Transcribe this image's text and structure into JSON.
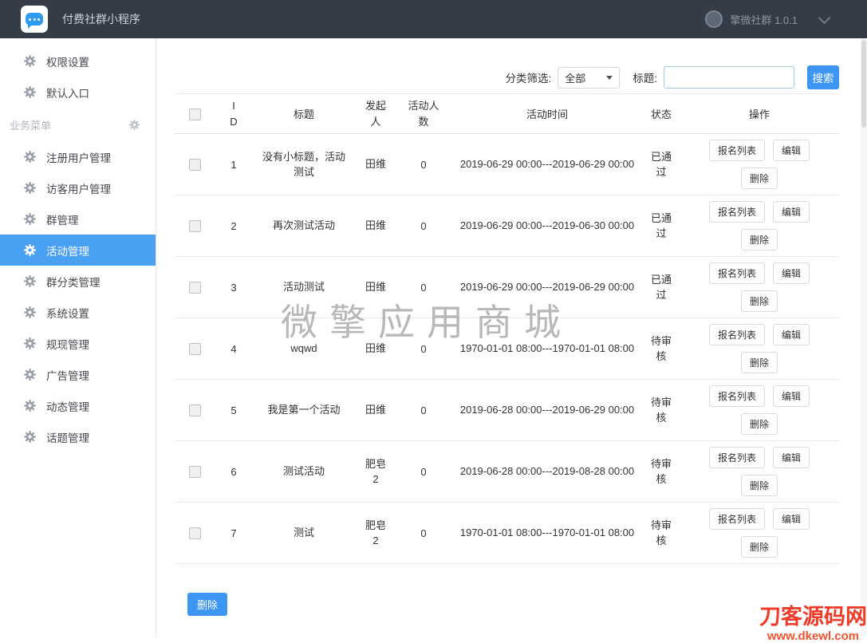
{
  "header": {
    "app_title": "付费社群小程序",
    "brand_label": "擎微社群 1.0.1"
  },
  "sidebar": {
    "top_items": [
      {
        "label": "权限设置"
      },
      {
        "label": "默认入口"
      }
    ],
    "section": {
      "label": "业务菜单"
    },
    "menu_items": [
      {
        "label": "注册用户管理",
        "active": false
      },
      {
        "label": "访客用户管理",
        "active": false
      },
      {
        "label": "群管理",
        "active": false
      },
      {
        "label": "活动管理",
        "active": true
      },
      {
        "label": "群分类管理",
        "active": false
      },
      {
        "label": "系统设置",
        "active": false
      },
      {
        "label": "规现管理",
        "active": false
      },
      {
        "label": "广告管理",
        "active": false
      },
      {
        "label": "动态管理",
        "active": false
      },
      {
        "label": "话题管理",
        "active": false
      }
    ]
  },
  "filters": {
    "category_label": "分类筛选:",
    "category_value": "全部",
    "title_label": "标题:",
    "title_value": "",
    "search_button": "搜索"
  },
  "table": {
    "columns": [
      "ID",
      "标题",
      "发起人",
      "活动人数",
      "活动时间",
      "状态",
      "操作"
    ],
    "actions": {
      "signup_list": "报名列表",
      "edit": "编辑",
      "delete": "删除"
    },
    "rows": [
      {
        "id": "1",
        "title": "没有小标题，活动测试",
        "initiator": "田维",
        "count": "0",
        "time": "2019-06-29 00:00---2019-06-29 00:00",
        "status": "已通过"
      },
      {
        "id": "2",
        "title": "再次测试活动",
        "initiator": "田维",
        "count": "0",
        "time": "2019-06-29 00:00---2019-06-30 00:00",
        "status": "已通过"
      },
      {
        "id": "3",
        "title": "活动测试",
        "initiator": "田维",
        "count": "0",
        "time": "2019-06-29 00:00---2019-06-29 00:00",
        "status": "已通过"
      },
      {
        "id": "4",
        "title": "wqwd",
        "initiator": "田维",
        "count": "0",
        "time": "1970-01-01 08:00---1970-01-01 08:00",
        "status": "待审核"
      },
      {
        "id": "5",
        "title": "我是第一个活动",
        "initiator": "田维",
        "count": "0",
        "time": "2019-06-28 00:00---2019-06-29 00:00",
        "status": "待审核"
      },
      {
        "id": "6",
        "title": "测试活动",
        "initiator": "肥皂2",
        "count": "0",
        "time": "2019-06-28 00:00---2019-08-28 00:00",
        "status": "待审核"
      },
      {
        "id": "7",
        "title": "测试",
        "initiator": "肥皂2",
        "count": "0",
        "time": "1970-01-01 08:00---1970-01-01 08:00",
        "status": "待审核"
      }
    ]
  },
  "footer": {
    "bulk_delete_button": "删除"
  },
  "watermarks": {
    "center": "微擎应用商城",
    "corner_title": "刀客源码网",
    "corner_subtitle": "www.dkewl.com"
  },
  "colors": {
    "accent_blue": "#3d96f2",
    "header_bg": "#343c48",
    "active_item_bg": "#4aa0f3",
    "watermark_red": "#f03b28"
  }
}
